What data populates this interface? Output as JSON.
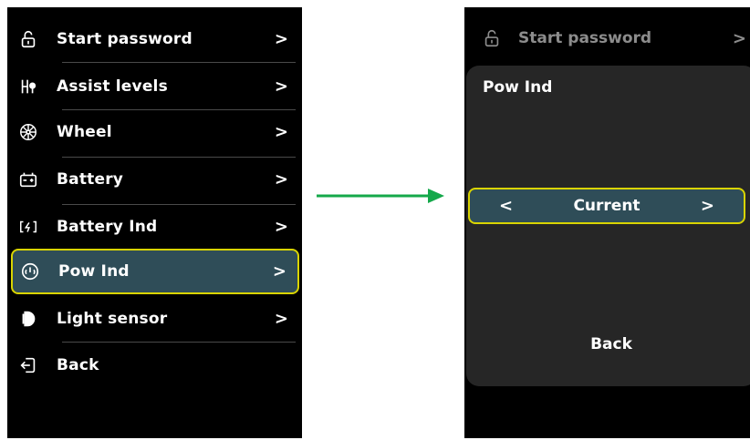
{
  "left_menu": {
    "items": [
      {
        "label": "Start password",
        "icon": "unlock-icon",
        "chevron": ">"
      },
      {
        "label": "Assist levels",
        "icon": "assist-levels-icon",
        "chevron": ">"
      },
      {
        "label": "Wheel",
        "icon": "wheel-icon",
        "chevron": ">"
      },
      {
        "label": "Battery",
        "icon": "battery-icon",
        "chevron": ">"
      },
      {
        "label": "Battery Ind",
        "icon": "battery-indicator-icon",
        "chevron": ">"
      },
      {
        "label": "Pow Ind",
        "icon": "power-gauge-icon",
        "chevron": ">",
        "selected": true
      },
      {
        "label": "Light sensor",
        "icon": "light-sensor-icon",
        "chevron": ">"
      },
      {
        "label": "Back",
        "icon": "back-icon"
      }
    ]
  },
  "right_screen": {
    "header": {
      "label": "Start password",
      "icon": "unlock-icon",
      "chevron": ">"
    },
    "panel": {
      "title": "Pow Ind",
      "selector": {
        "prev": "<",
        "value": "Current",
        "next": ">"
      },
      "back_label": "Back"
    }
  },
  "colors": {
    "screen_bg": "#000000",
    "panel_bg": "#262626",
    "selected_bg": "#2f4d58",
    "selected_border": "#d9d400",
    "arrow": "#14a84a"
  }
}
